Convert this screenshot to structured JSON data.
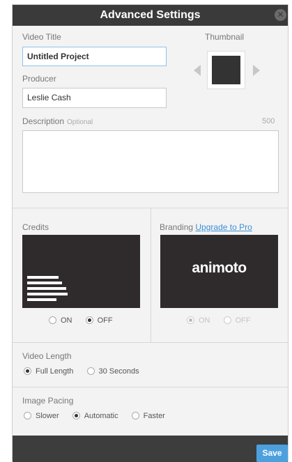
{
  "dialog": {
    "title": "Advanced Settings",
    "close_glyph": "✕"
  },
  "video_title": {
    "label": "Video Title",
    "value": "Untitled Project"
  },
  "producer": {
    "label": "Producer",
    "value": "Leslie Cash"
  },
  "thumbnail": {
    "label": "Thumbnail"
  },
  "description": {
    "label": "Description",
    "optional": "Optional",
    "char_limit": "500",
    "value": ""
  },
  "credits": {
    "label": "Credits",
    "options": [
      "ON",
      "OFF"
    ],
    "selected": "OFF"
  },
  "branding": {
    "label": "Branding",
    "upgrade_link": "Upgrade to Pro",
    "logo_text": "animoto",
    "options": [
      "ON",
      "OFF"
    ],
    "selected": "ON",
    "disabled": true
  },
  "video_length": {
    "label": "Video Length",
    "options": [
      "Full Length",
      "30 Seconds"
    ],
    "selected": "Full Length"
  },
  "image_pacing": {
    "label": "Image Pacing",
    "options": [
      "Slower",
      "Automatic",
      "Faster"
    ],
    "selected": "Automatic"
  },
  "footer": {
    "save_label": "Save"
  },
  "colors": {
    "titlebar": "#3a3a3a",
    "accent": "#4da0de",
    "preview_bg": "#2f2b2c"
  }
}
